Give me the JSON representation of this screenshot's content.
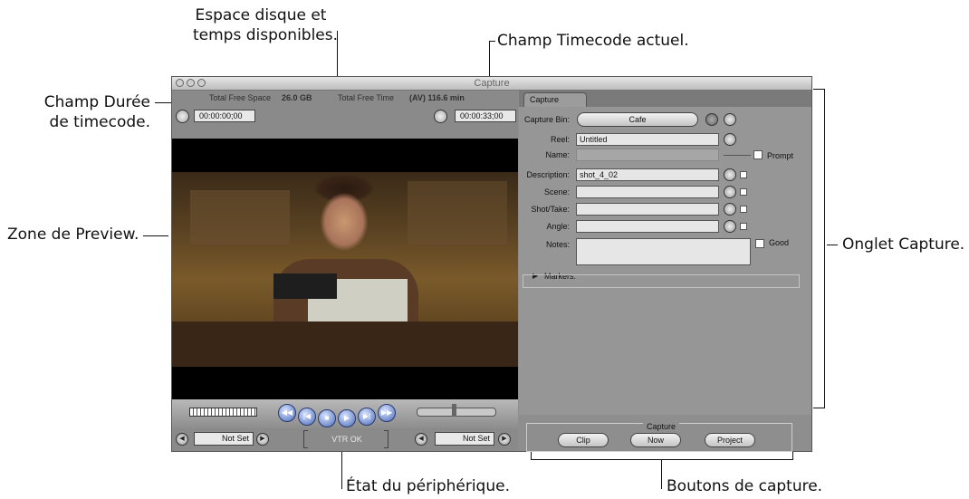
{
  "window": {
    "title": "Capture",
    "total_free_space_label": "Total Free Space",
    "total_free_space_value": "26.0 GB",
    "total_free_time_label": "Total Free Time",
    "total_free_time_value": "(AV) 116.6 min",
    "duration_timecode": "00:00:00;00",
    "current_timecode": "00:00:33;00"
  },
  "transport": {
    "in_point_value": "Not Set",
    "out_point_value": "Not Set",
    "device_status": "VTR OK"
  },
  "capture_tab": {
    "tab_label": "Capture",
    "capture_bin_label": "Capture Bin:",
    "capture_bin_value": "Cafe",
    "reel_label": "Reel:",
    "reel_value": "Untitled",
    "name_label": "Name:",
    "name_value": "",
    "prompt_label": "Prompt",
    "description_label": "Description:",
    "description_value": "shot_4_02",
    "scene_label": "Scene:",
    "scene_value": "",
    "shot_take_label": "Shot/Take:",
    "shot_take_value": "",
    "angle_label": "Angle:",
    "angle_value": "",
    "notes_label": "Notes:",
    "notes_value": "",
    "good_label": "Good",
    "markers_label": "Markers:"
  },
  "capture_buttons": {
    "group_label": "Capture",
    "clip_label": "Clip",
    "now_label": "Now",
    "project_label": "Project"
  },
  "callouts": {
    "disk_space_line1": "Espace disque et",
    "disk_space_line2": "temps disponibles.",
    "current_timecode": "Champ Timecode actuel.",
    "duration_line1": "Champ Durée",
    "duration_line2": "de timecode.",
    "preview": "Zone de Preview.",
    "capture_tab": "Onglet Capture.",
    "device_status": "État du périphérique.",
    "capture_buttons": "Boutons de capture."
  },
  "icons": {
    "window_controls": [
      "close-icon",
      "minimize-icon",
      "zoom-icon"
    ],
    "transport_controls": [
      "rewind-icon",
      "step-back-icon",
      "stop-icon",
      "play-icon",
      "step-forward-icon",
      "fast-forward-icon"
    ]
  }
}
